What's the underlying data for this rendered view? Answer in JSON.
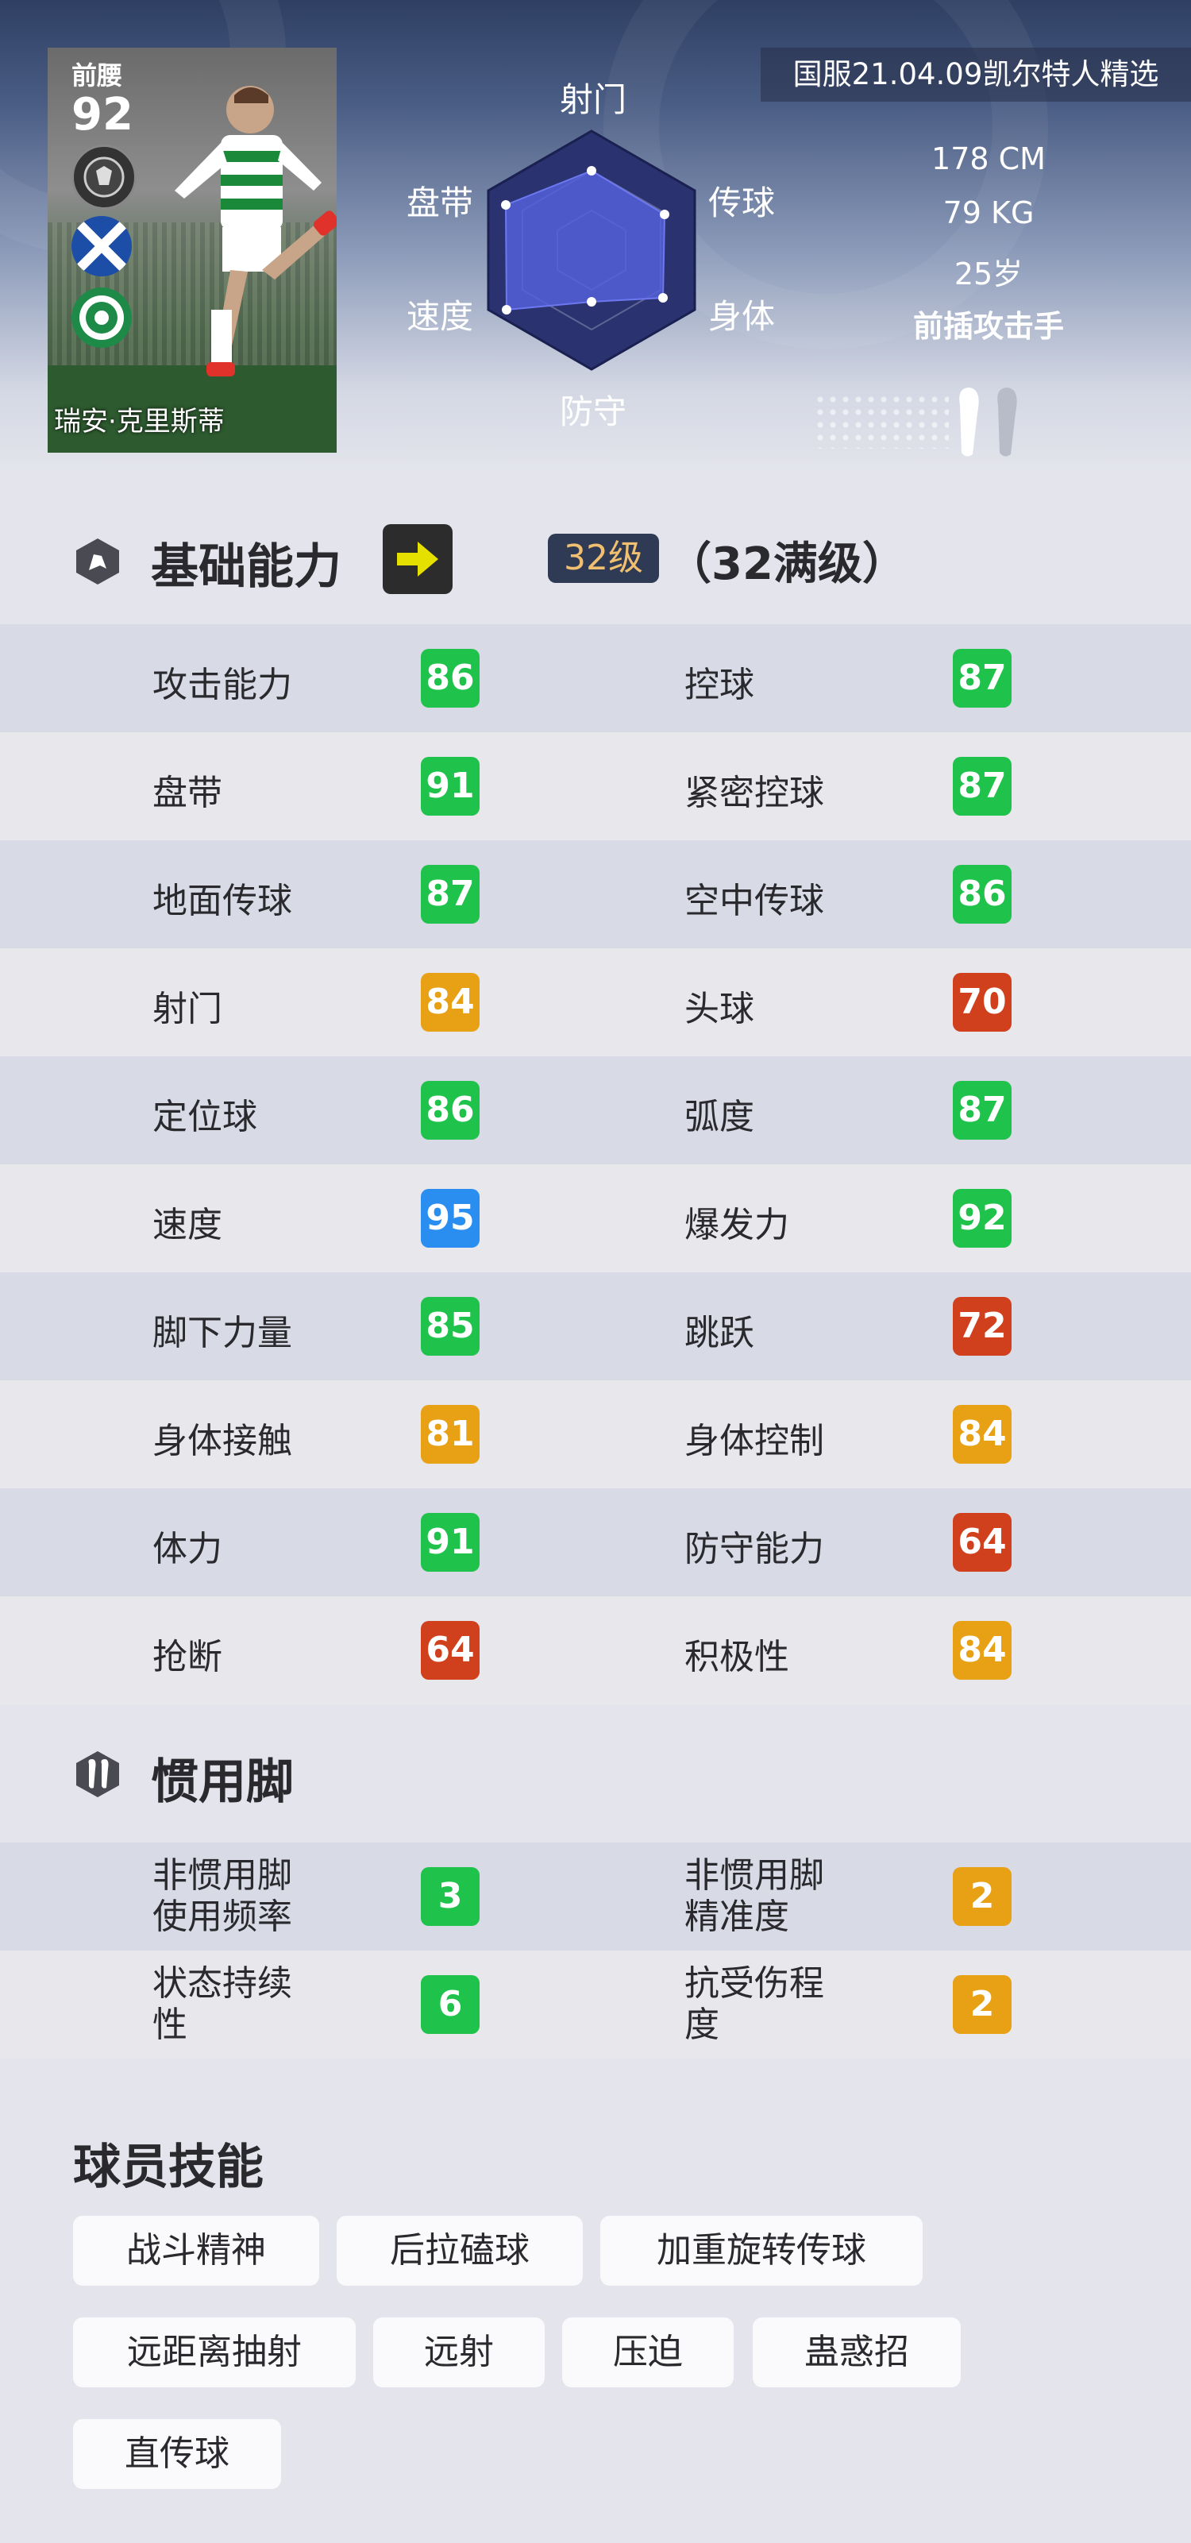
{
  "card": {
    "position": "前腰",
    "rating": "92",
    "name": "瑞安·克里斯蒂"
  },
  "version_tag": "国服21.04.09凯尔特人精选",
  "radar": {
    "labels": {
      "shooting": "射门",
      "passing": "传球",
      "physical": "身体",
      "defending": "防守",
      "speed": "速度",
      "dribbling": "盘带"
    },
    "fill_color": "#5560d8",
    "base_color": "#2a3270"
  },
  "info": {
    "height": "178 CM",
    "weight": "79 KG",
    "age": "25岁",
    "role": "前插攻击手"
  },
  "abilities": {
    "title": "基础能力",
    "level": "32级",
    "level_max": "（32满级）",
    "rows": [
      {
        "l_name": "攻击能力",
        "l_val": "86",
        "l_color": "#1fc24a",
        "r_name": "控球",
        "r_val": "87",
        "r_color": "#1fc24a"
      },
      {
        "l_name": "盘带",
        "l_val": "91",
        "l_color": "#1fc24a",
        "r_name": "紧密控球",
        "r_val": "87",
        "r_color": "#1fc24a"
      },
      {
        "l_name": "地面传球",
        "l_val": "87",
        "l_color": "#1fc24a",
        "r_name": "空中传球",
        "r_val": "86",
        "r_color": "#1fc24a"
      },
      {
        "l_name": "射门",
        "l_val": "84",
        "l_color": "#e8a014",
        "r_name": "头球",
        "r_val": "70",
        "r_color": "#d0401c"
      },
      {
        "l_name": "定位球",
        "l_val": "86",
        "l_color": "#1fc24a",
        "r_name": "弧度",
        "r_val": "87",
        "r_color": "#1fc24a"
      },
      {
        "l_name": "速度",
        "l_val": "95",
        "l_color": "#2a8ef0",
        "r_name": "爆发力",
        "r_val": "92",
        "r_color": "#1fc24a"
      },
      {
        "l_name": "脚下力量",
        "l_val": "85",
        "l_color": "#1fc24a",
        "r_name": "跳跃",
        "r_val": "72",
        "r_color": "#d0401c"
      },
      {
        "l_name": "身体接触",
        "l_val": "81",
        "l_color": "#e8a014",
        "r_name": "身体控制",
        "r_val": "84",
        "r_color": "#e8a014"
      },
      {
        "l_name": "体力",
        "l_val": "91",
        "l_color": "#1fc24a",
        "r_name": "防守能力",
        "r_val": "64",
        "r_color": "#d0401c"
      },
      {
        "l_name": "抢断",
        "l_val": "64",
        "l_color": "#d0401c",
        "r_name": "积极性",
        "r_val": "84",
        "r_color": "#e8a014"
      }
    ]
  },
  "foot": {
    "title": "惯用脚",
    "rows": [
      {
        "l_line1": "非惯用脚",
        "l_line2": "使用频率",
        "l_val": "3",
        "l_color": "#1fc24a",
        "r_line1": "非惯用脚",
        "r_line2": "精准度",
        "r_val": "2",
        "r_color": "#e8a014"
      },
      {
        "l_line1": "状态持续",
        "l_line2": "性",
        "l_val": "6",
        "l_color": "#1fc24a",
        "r_line1": "抗受伤程",
        "r_line2": "度",
        "r_val": "2",
        "r_color": "#e8a014"
      }
    ]
  },
  "skills": {
    "title": "球员技能",
    "items": [
      "战斗精神",
      "后拉磕球",
      "加重旋转传球",
      "远距离抽射",
      "远射",
      "压迫",
      "蛊惑招",
      "直传球"
    ]
  }
}
